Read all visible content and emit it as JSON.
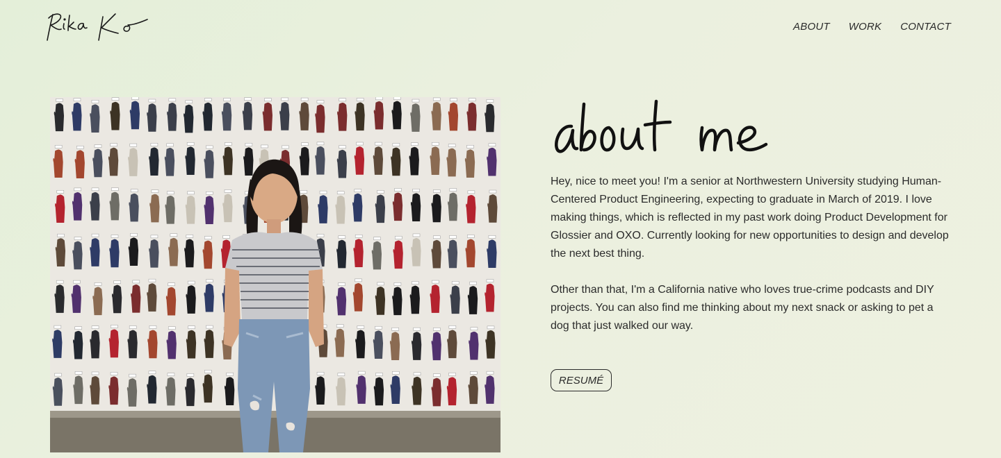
{
  "header": {
    "logo_text": "Rika Ko",
    "nav": [
      {
        "label": "ABOUT"
      },
      {
        "label": "WORK"
      },
      {
        "label": "CONTACT"
      }
    ]
  },
  "about": {
    "heading": "about me",
    "paragraphs": [
      "Hey, nice to meet you! I'm a senior at Northwestern University studying Human-Centered Product Engineering, expecting to graduate in March of 2019. I love making things, which is reflected in my past work doing Product Development for Glossier and OXO. Currently looking for new opportunities to design and develop the next best thing.",
      "Other than that, I'm a California native who loves true-crime podcasts and DIY projects. You can also find me thinking about my next snack or asking to pet a dog that just walked our way."
    ],
    "resume_label": "RESUMÉ"
  },
  "colors": {
    "background": "#e9efdc",
    "text": "#2b2b2b"
  }
}
